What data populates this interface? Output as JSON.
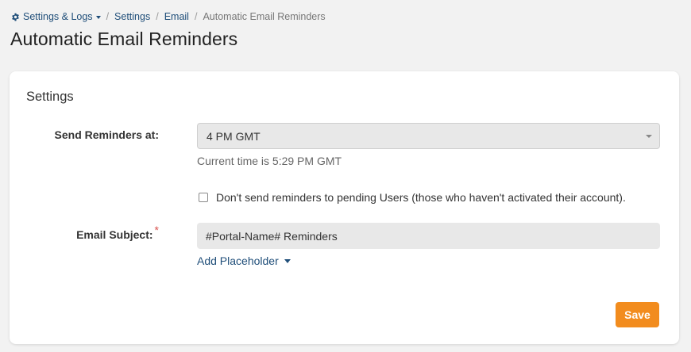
{
  "breadcrumb": {
    "root_label": "Settings & Logs",
    "root_icon": "gear-icon",
    "items": [
      "Settings",
      "Email"
    ],
    "current": "Automatic Email Reminders",
    "separator": "/"
  },
  "page": {
    "title": "Automatic Email Reminders"
  },
  "settings": {
    "section_title": "Settings",
    "send_reminders": {
      "label": "Send Reminders at:",
      "selected": "4 PM GMT",
      "help": "Current time is 5:29 PM GMT"
    },
    "pending_users": {
      "label": "Don't send reminders to pending Users (those who haven't activated their account).",
      "checked": false
    },
    "email_subject": {
      "label": "Email Subject:",
      "required_mark": "*",
      "value": "#Portal-Name# Reminders"
    },
    "add_placeholder_label": "Add Placeholder",
    "save_label": "Save"
  },
  "colors": {
    "link": "#1f4e79",
    "accent": "#f28c1e",
    "required": "#d9534f",
    "background": "#f2f2f2",
    "card": "#ffffff"
  }
}
